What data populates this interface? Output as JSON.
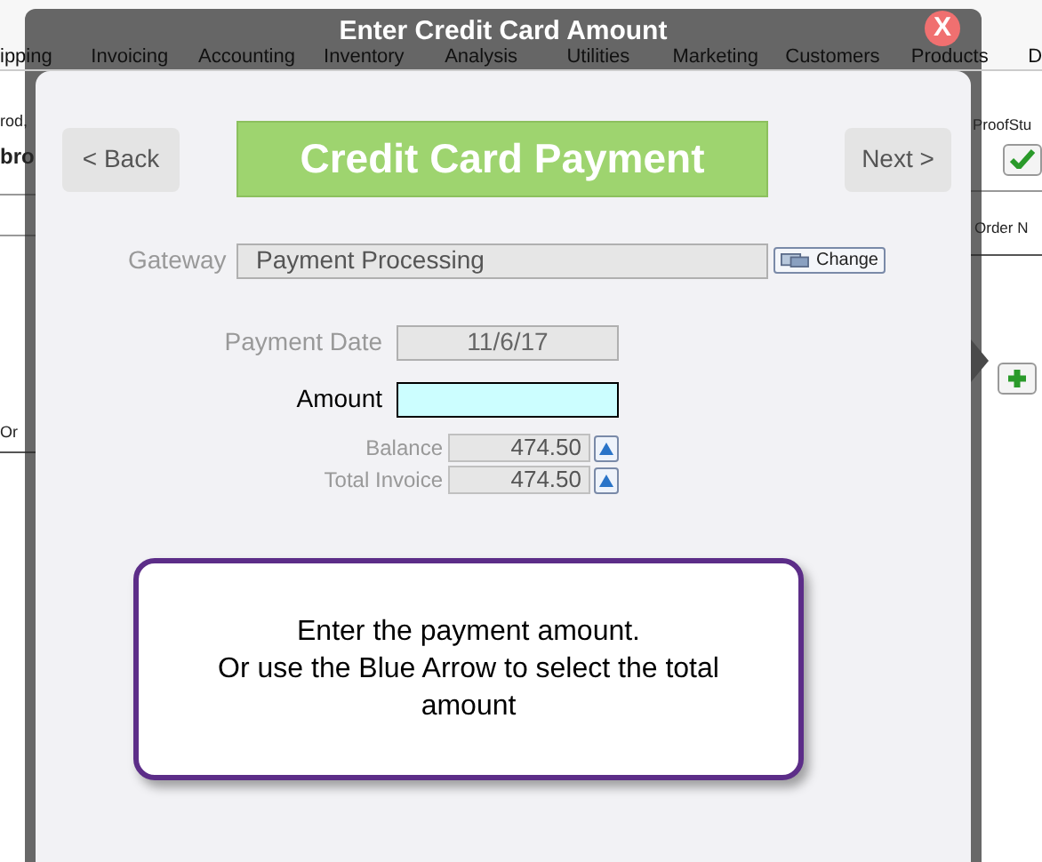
{
  "background": {
    "toolbar": [
      "ipping",
      "Invoicing",
      "Accounting",
      "Inventory",
      "Analysis",
      "Utilities",
      "Marketing",
      "Customers",
      "Products",
      "D"
    ],
    "left_column": [
      "rod,",
      "bro",
      "Or"
    ],
    "right_column": [
      "ProofStu",
      "Order N"
    ]
  },
  "dialog": {
    "title": "Enter Credit Card Amount",
    "close": "X",
    "back": "< Back",
    "heading": "Credit Card Payment",
    "next": "Next >",
    "gateway": {
      "label": "Gateway",
      "value": "Payment Processing",
      "button": "Change"
    },
    "payment_date": {
      "label": "Payment Date",
      "value": "11/6/17"
    },
    "amount": {
      "label": "Amount"
    },
    "totals": [
      {
        "label": "Balance",
        "value": "474.50"
      },
      {
        "label": "Total Invoice",
        "value": "474.50"
      }
    ],
    "callout": [
      "Enter the payment amount.",
      "Or use the Blue Arrow to select the total amount"
    ]
  }
}
